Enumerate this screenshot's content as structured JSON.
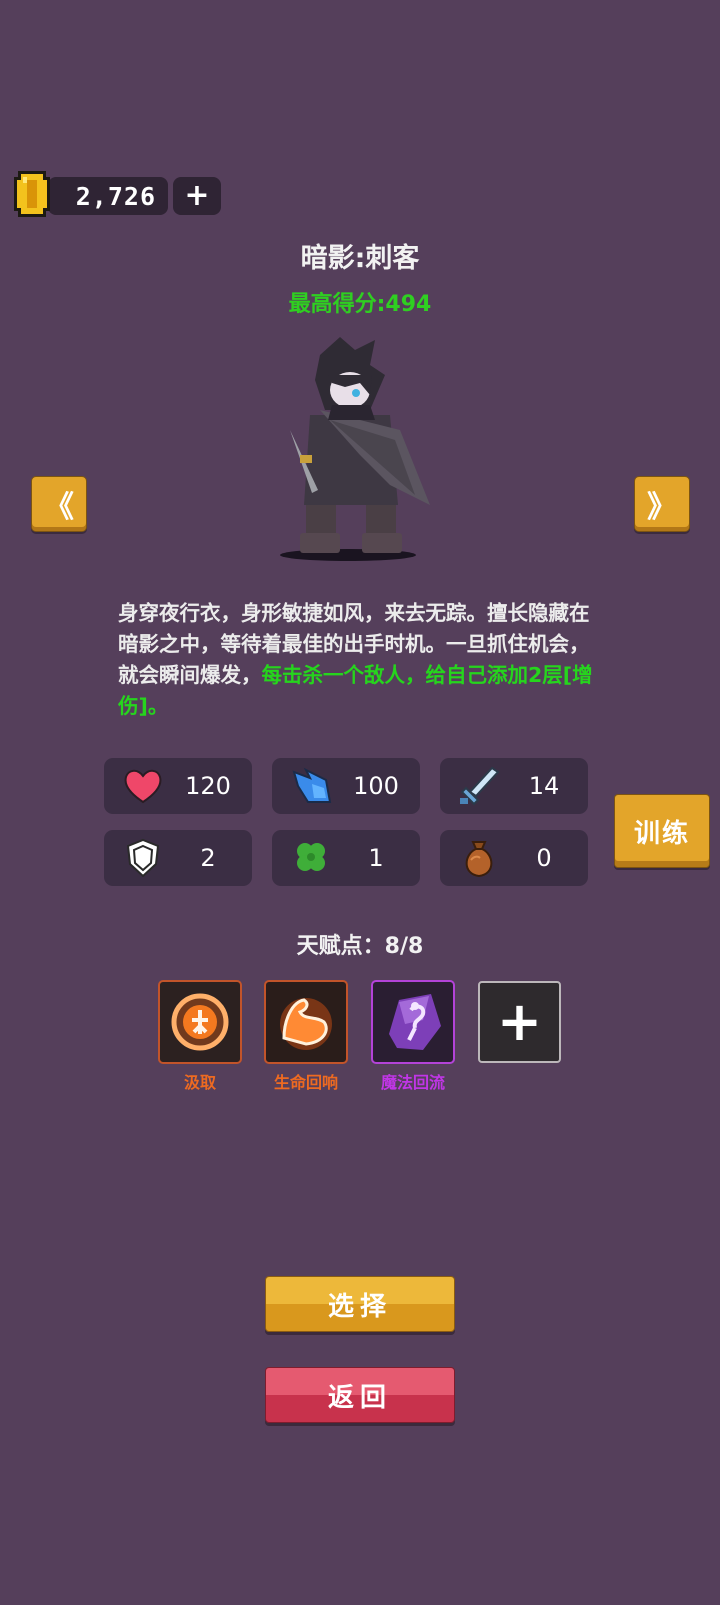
{
  "currency": {
    "coins": "2,726",
    "add_label": "+",
    "icon": "gold-coin-icon"
  },
  "hero": {
    "title": "暗影:刺客",
    "best_score": "最高得分:494",
    "description_plain": "身穿夜行衣，身形敏捷如风，来去无踪。擅长隐藏在暗影之中，等待着最佳的出手时机。一旦抓住机会，就会瞬间爆发，",
    "description_highlight": "每击杀一个敌人，给自己添加2层[增伤]。",
    "description_end": "。"
  },
  "nav": {
    "prev": "《",
    "next": "》"
  },
  "stats": [
    {
      "icon": "heart-icon",
      "value": "120"
    },
    {
      "icon": "speed-icon",
      "value": "100"
    },
    {
      "icon": "sword-icon",
      "value": "14"
    },
    {
      "icon": "shield-icon",
      "value": "2"
    },
    {
      "icon": "clover-icon",
      "value": "1"
    },
    {
      "icon": "money-bag-icon",
      "value": "0"
    }
  ],
  "train_label": "训练",
  "talent": {
    "label": "天赋点：8/8",
    "skills": [
      {
        "name": "汲取",
        "color": "#ee6a21"
      },
      {
        "name": "生命回响",
        "color": "#ee6a21"
      },
      {
        "name": "魔法回流",
        "color": "#c036e6"
      }
    ],
    "add_label": "+"
  },
  "buttons": {
    "select": "选择",
    "back": "返回"
  }
}
